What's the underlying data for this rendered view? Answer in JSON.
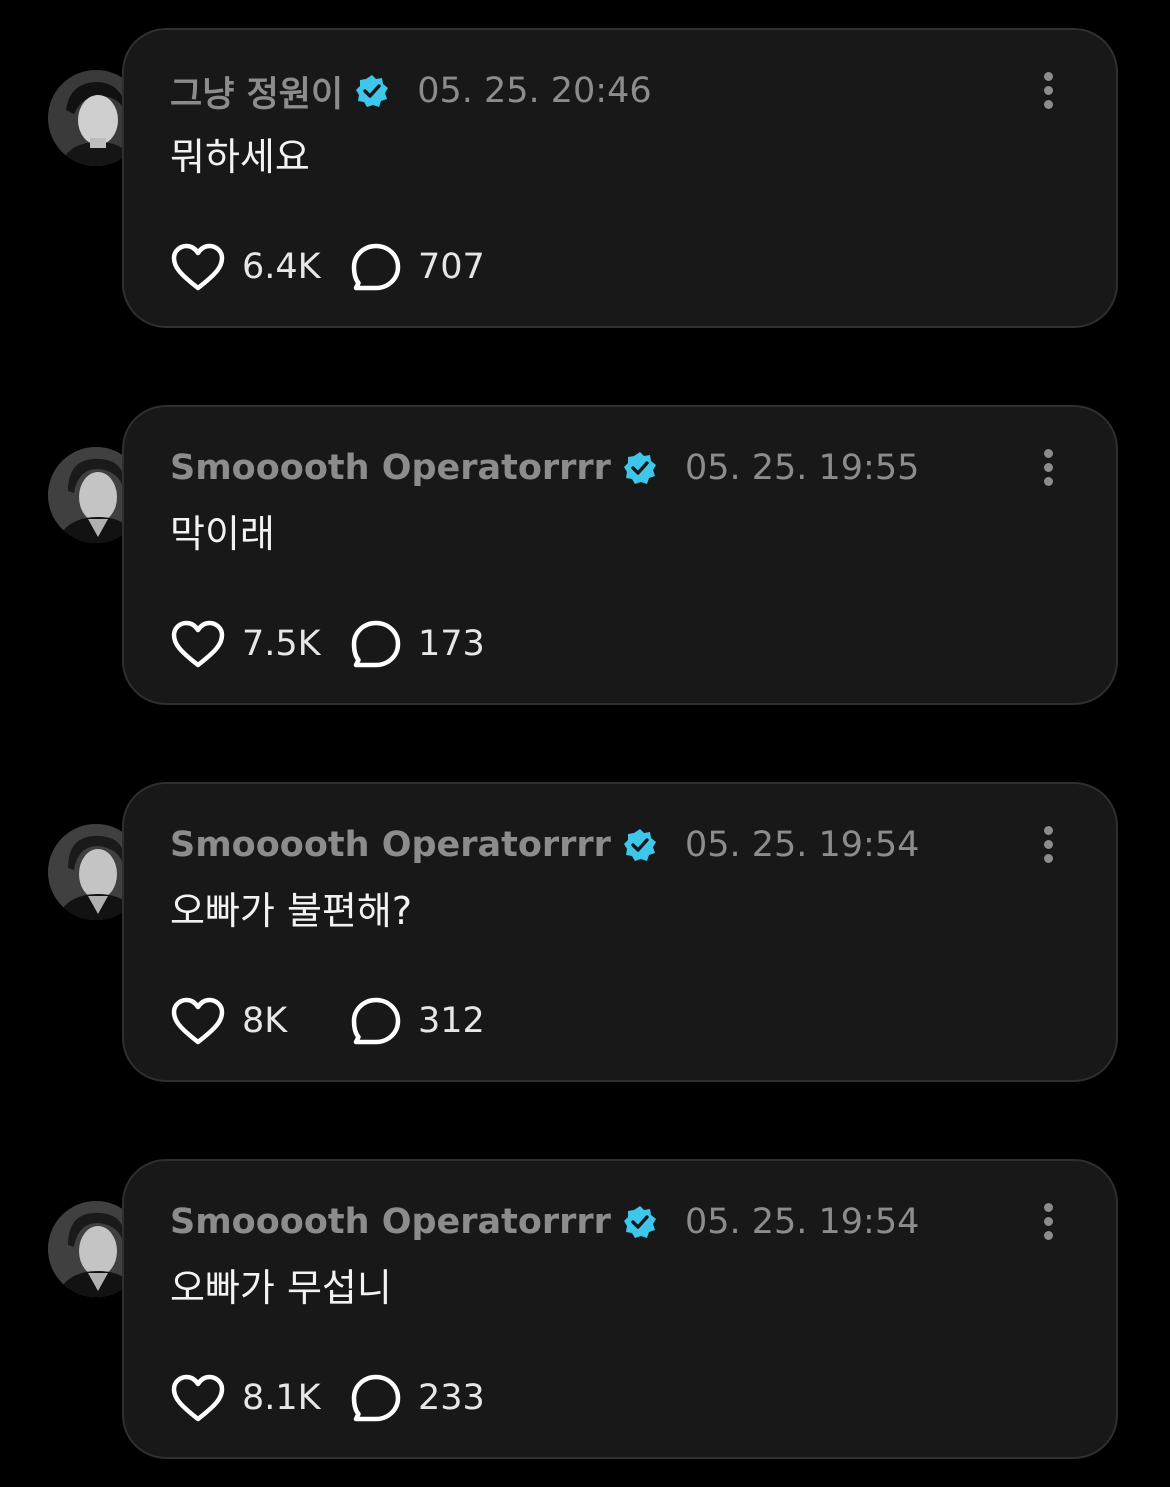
{
  "colors": {
    "background": "#000000",
    "card": "#181818",
    "card_border": "#2f2f2f",
    "muted_text": "#8c8c8c",
    "verified_badge": "#3ec7ea"
  },
  "posts": [
    {
      "author": "그냥 정원이",
      "verified": true,
      "timestamp": "05. 25. 20:46",
      "text": "뭐하세요",
      "likes": "6.4K",
      "comments": "707",
      "icons": {
        "like": "heart-icon",
        "comment": "comment-bubble-icon",
        "menu": "more-vertical-icon"
      }
    },
    {
      "author": "Smooooth Operatorrrr",
      "verified": true,
      "timestamp": "05. 25. 19:55",
      "text": "막이래",
      "likes": "7.5K",
      "comments": "173",
      "icons": {
        "like": "heart-icon",
        "comment": "comment-bubble-icon",
        "menu": "more-vertical-icon"
      }
    },
    {
      "author": "Smooooth Operatorrrr",
      "verified": true,
      "timestamp": "05. 25. 19:54",
      "text": "오빠가 불편해?",
      "likes": "8K",
      "comments": "312",
      "icons": {
        "like": "heart-icon",
        "comment": "comment-bubble-icon",
        "menu": "more-vertical-icon"
      }
    },
    {
      "author": "Smooooth Operatorrrr",
      "verified": true,
      "timestamp": "05. 25. 19:54",
      "text": "오빠가 무섭니",
      "likes": "8.1K",
      "comments": "233",
      "icons": {
        "like": "heart-icon",
        "comment": "comment-bubble-icon",
        "menu": "more-vertical-icon"
      }
    }
  ]
}
